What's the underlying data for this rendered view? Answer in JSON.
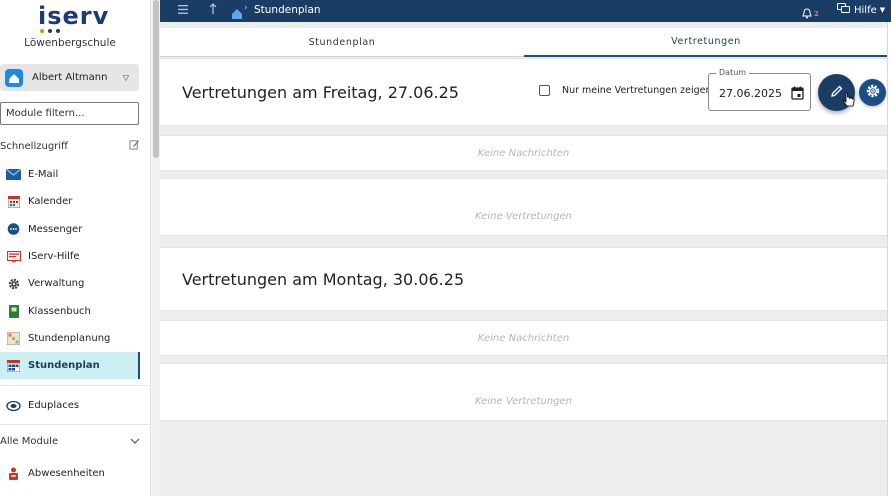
{
  "sidebar": {
    "logo_text": "iserv",
    "school": "Löwenbergschule",
    "user_name": "Albert Altmann",
    "filter_placeholder": "Module filtern...",
    "quick_access_label": "Schnellzugriff",
    "quick_items": [
      {
        "label": "E-Mail",
        "icon": "mail-icon"
      },
      {
        "label": "Kalender",
        "icon": "calendar-icon"
      },
      {
        "label": "Messenger",
        "icon": "chat-icon"
      },
      {
        "label": "IServ-Hilfe",
        "icon": "help-screen-icon"
      },
      {
        "label": "Verwaltung",
        "icon": "gear-icon"
      },
      {
        "label": "Klassenbuch",
        "icon": "book-icon"
      },
      {
        "label": "Stundenplanung",
        "icon": "planning-icon"
      },
      {
        "label": "Stundenplan",
        "icon": "timetable-icon",
        "active": true
      }
    ],
    "eduplaces_label": "Eduplaces",
    "all_modules_label": "Alle Module",
    "module_items": [
      {
        "label": "Abwesenheiten",
        "icon": "absence-icon"
      }
    ]
  },
  "topbar": {
    "breadcrumb": "Stundenplan",
    "notification_count": "2",
    "help_label": "Hilfe"
  },
  "tabs": [
    {
      "label": "Stundenplan",
      "active": false
    },
    {
      "label": "Vertretungen",
      "active": true
    }
  ],
  "filter": {
    "checkbox_label": "Nur meine Vertretungen zeigen",
    "date_legend": "Datum",
    "date_value": "27.06.2025"
  },
  "days": [
    {
      "title": "Vertretungen am Freitag, 27.06.25",
      "messages": "Keine Nachrichten",
      "substitutions": "Keine Vertretungen"
    },
    {
      "title": "Vertretungen am Montag, 30.06.25",
      "messages": "Keine Nachrichten",
      "substitutions": "Keine Vertretungen"
    }
  ],
  "colors": {
    "primary": "#1a3d66",
    "active_nav": "#cdeef2",
    "badge": "#ff7043"
  }
}
